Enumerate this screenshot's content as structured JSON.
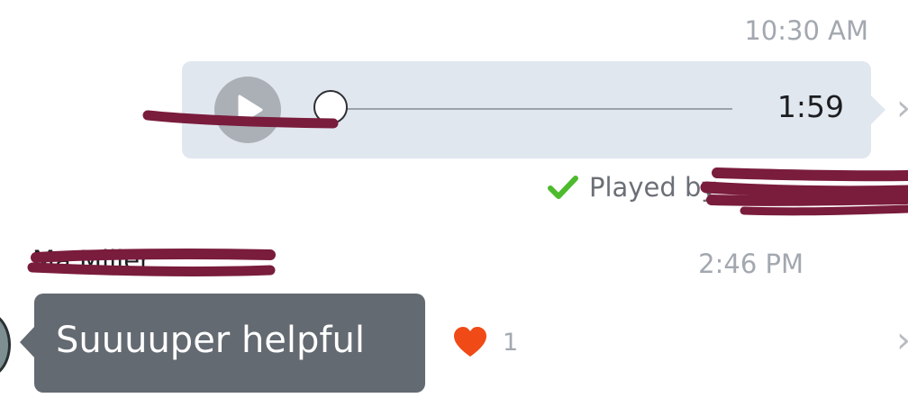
{
  "outgoing_message": {
    "timestamp": "10:30 AM",
    "duration": "1:59",
    "played_by": "Played by",
    "progress": 0
  },
  "incoming_message": {
    "timestamp": "2:46 PM",
    "sender": "Ma       Miller",
    "text": "Suuuuper helpful",
    "reaction_count": "1"
  },
  "icons": {
    "play": "play-icon",
    "check": "check-icon",
    "heart": "heart-icon",
    "chevron": "chevron-right-icon"
  },
  "colors": {
    "voice_bubble": "#e1e7ef",
    "text_bubble": "#646a71",
    "check": "#4cbb2d",
    "heart": "#f04a16",
    "redaction": "#7a1c3c"
  }
}
